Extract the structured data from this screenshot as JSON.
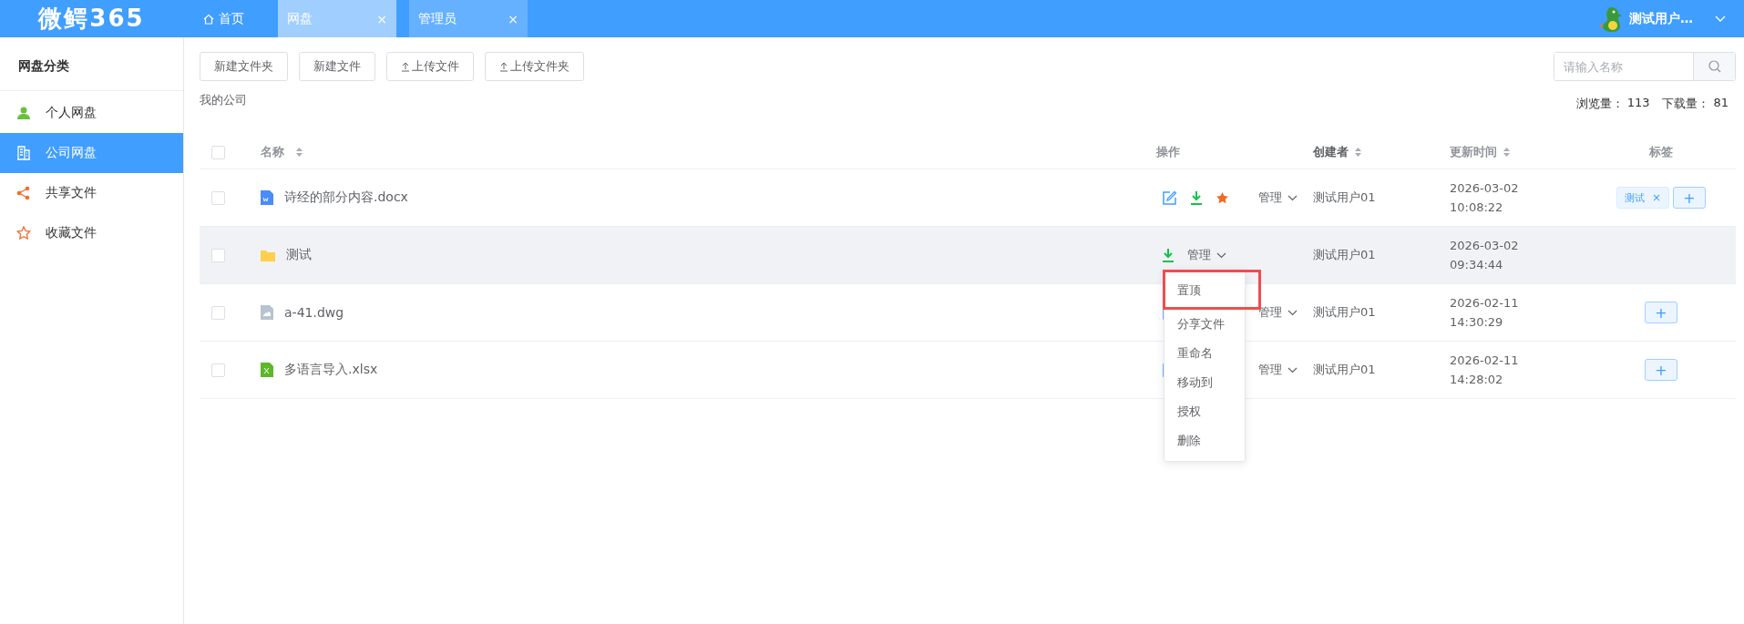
{
  "header": {
    "logo": "微鳄365",
    "tabs": [
      {
        "label": "首页",
        "kind": "home",
        "selected": false
      },
      {
        "label": "网盘",
        "kind": "closable",
        "selected": true,
        "close": "×"
      },
      {
        "label": "管理员",
        "kind": "closable",
        "selected": false,
        "close": "×"
      }
    ],
    "user": {
      "name": "测试用户…"
    }
  },
  "sidebar": {
    "title": "网盘分类",
    "items": [
      {
        "label": "个人网盘",
        "kind": "person",
        "selected": false
      },
      {
        "label": "公司网盘",
        "kind": "building",
        "selected": true
      },
      {
        "label": "共享文件",
        "kind": "share",
        "selected": false
      },
      {
        "label": "收藏文件",
        "kind": "star",
        "selected": false
      }
    ]
  },
  "toolbar": {
    "buttons": [
      {
        "label": "新建文件夹",
        "upload": false
      },
      {
        "label": "新建文件",
        "upload": false
      },
      {
        "label": "上传文件",
        "upload": true
      },
      {
        "label": "上传文件夹",
        "upload": true
      }
    ],
    "search": {
      "placeholder": "请输入名称"
    }
  },
  "breadcrumb": "我的公司",
  "stats": [
    {
      "label": "浏览量：",
      "value": "113"
    },
    {
      "label": "下载量：",
      "value": "81"
    }
  ],
  "table": {
    "select_all_checked": false,
    "columns": [
      {
        "label": "名称",
        "sortable": true
      },
      {
        "label": "操作",
        "sortable": false
      },
      {
        "label": "创建者",
        "sortable": true
      },
      {
        "label": "更新时间",
        "sortable": true
      },
      {
        "label": "标签",
        "sortable": false
      }
    ],
    "rows": [
      {
        "checked": false,
        "highlighted": false,
        "kind": "word",
        "name": "诗经的部分内容.docx",
        "actions": [
          {
            "kind": "edit"
          },
          {
            "kind": "download"
          },
          {
            "kind": "star"
          }
        ],
        "manage": "管理",
        "expanded": false,
        "creator": "测试用户01",
        "date": "2026-03-02",
        "time": "10:08:22",
        "tags": [
          {
            "label": "测试",
            "remove": "×"
          }
        ],
        "add": "+"
      },
      {
        "checked": false,
        "highlighted": true,
        "kind": "folder",
        "name": "测试",
        "actions": [
          {
            "kind": "download"
          }
        ],
        "manage": "管理",
        "expanded": true,
        "creator": "测试用户01",
        "date": "2026-03-02",
        "time": "09:34:44",
        "tags": []
      },
      {
        "checked": false,
        "highlighted": false,
        "kind": "cad",
        "name": "a-41.dwg",
        "actions": [
          {
            "kind": "edit"
          }
        ],
        "manage": "管理",
        "expanded": false,
        "creator": "测试用户01",
        "date": "2026-02-11",
        "time": "14:30:29",
        "tags": [],
        "add": "+"
      },
      {
        "checked": false,
        "highlighted": false,
        "kind": "excel",
        "name": "多语言导入.xlsx",
        "actions": [
          {
            "kind": "edit"
          }
        ],
        "manage": "管理",
        "expanded": false,
        "creator": "测试用户01",
        "date": "2026-02-11",
        "time": "14:28:02",
        "tags": [],
        "add": "+"
      }
    ]
  },
  "menu": {
    "items": [
      {
        "label": "置顶",
        "outlined": true
      },
      {
        "label": "分享文件",
        "outlined": false
      },
      {
        "label": "重命名",
        "outlined": false
      },
      {
        "label": "移动到",
        "outlined": false
      },
      {
        "label": "授权",
        "outlined": false
      },
      {
        "label": "删除",
        "outlined": false
      }
    ]
  }
}
